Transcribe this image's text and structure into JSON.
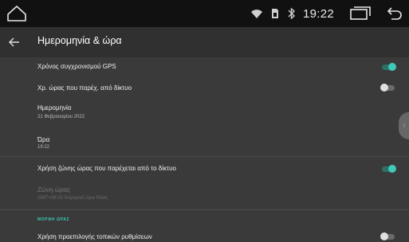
{
  "status_bar": {
    "time": "19:22",
    "icons": [
      "home-icon",
      "wifi-icon",
      "sim-card-icon",
      "bluetooth-icon",
      "recent-apps-icon",
      "back-icon"
    ]
  },
  "app_bar": {
    "title": "Ημερομηνία & ώρα",
    "back_icon": "back-arrow-icon"
  },
  "settings": {
    "gps_time": {
      "title": "Χρόνος συγχρονισμού GPS",
      "enabled": true
    },
    "network_time": {
      "title": "Χρ. ώρας που παρέχ. από δίκτυο",
      "enabled": false
    },
    "date": {
      "title": "Ημερομηνία",
      "value": "21 Φεβρουαρίου 2022"
    },
    "time": {
      "title": "Ώρα",
      "value": "19:22"
    },
    "network_timezone": {
      "title": "Χρήση ζώνης ώρας που παρέχεται από το δίκτυο",
      "enabled": true
    },
    "timezone": {
      "title": "Ζώνη ώρας",
      "value": "GMT+08:00 Χειμερινή ώρα Κίνας"
    },
    "time_format_header": "ΜΟΡΦΗ ΩΡΑΣ",
    "locale_default": {
      "title": "Χρήση προεπιλογής τοπικών ρυθμίσεων",
      "enabled": false
    }
  },
  "colors": {
    "accent": "#3ec9b8",
    "background": "#3a3a3a",
    "status_bar": "#111111",
    "app_bar": "#303030"
  }
}
